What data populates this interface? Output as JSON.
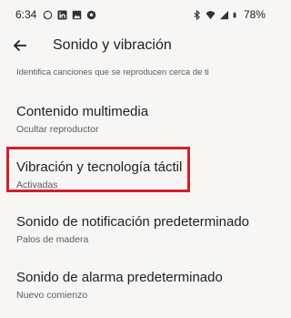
{
  "status_bar": {
    "time": "6:34",
    "battery": "78%",
    "left_icons": [
      "whatsapp-icon",
      "linkedin-icon",
      "photo-icon",
      "soccer-ball-icon"
    ],
    "right_icons": [
      "bluetooth-icon",
      "wifi-icon",
      "signal-icon",
      "battery-icon"
    ]
  },
  "app_bar": {
    "title": "Sonido y vibración"
  },
  "list": {
    "partial_item_subtitle": "Identifica canciones que se reproducen cerca de ti",
    "items": [
      {
        "title": "Contenido multimedia",
        "subtitle": "Ocultar reproductor"
      },
      {
        "title": "Vibración y tecnología táctil",
        "subtitle": "Activadas"
      },
      {
        "title": "Sonido de notificación predeterminado",
        "subtitle": "Palos de madera"
      },
      {
        "title": "Sonido de alarma predeterminado",
        "subtitle": "Nuevo comienzo"
      }
    ]
  },
  "colors": {
    "background": "#f7f6f4",
    "highlight_border": "#d3202a",
    "primary_text": "#1f1f1f",
    "secondary_text": "#5c5c5c"
  }
}
